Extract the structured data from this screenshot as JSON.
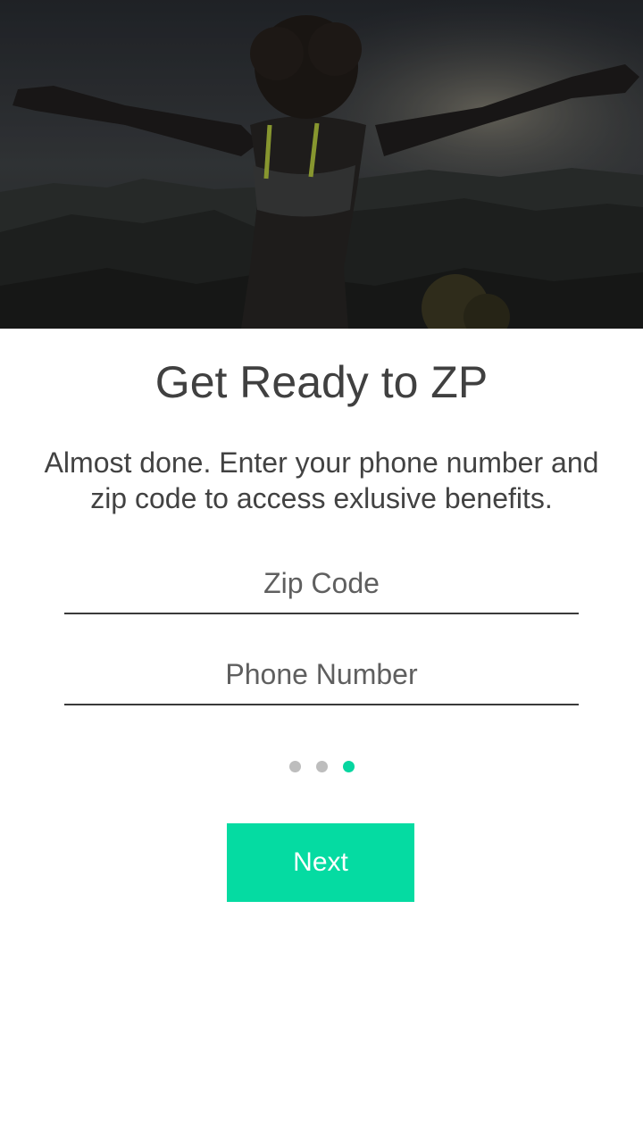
{
  "hero": {
    "image": "woman-arms-outstretched-over-city-photo"
  },
  "content": {
    "title": "Get Ready to ZP",
    "subtitle_line1": "Almost done. Enter your phone number and",
    "subtitle_line2": "zip code to access exlusive benefits."
  },
  "form": {
    "zip": {
      "value": "",
      "placeholder": "Zip Code"
    },
    "phone": {
      "value": "",
      "placeholder": "Phone Number"
    }
  },
  "pager": {
    "total": 3,
    "current": 3
  },
  "actions": {
    "next_label": "Next"
  },
  "colors": {
    "accent": "#05dba2",
    "dot_inactive": "#bdbdbd",
    "text": "#404040"
  }
}
